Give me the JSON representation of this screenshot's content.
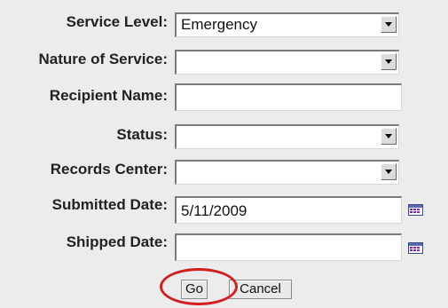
{
  "form": {
    "service_level": {
      "label": "Service Level:",
      "value": "Emergency"
    },
    "nature_of_service": {
      "label": "Nature of Service:",
      "value": ""
    },
    "recipient_name": {
      "label": "Recipient Name:",
      "value": ""
    },
    "status": {
      "label": "Status:",
      "value": ""
    },
    "records_center": {
      "label": "Records Center:",
      "value": ""
    },
    "submitted_date": {
      "label": "Submitted Date:",
      "value": "5/11/2009"
    },
    "shipped_date": {
      "label": "Shipped Date:",
      "value": ""
    }
  },
  "buttons": {
    "go": "Go",
    "cancel": "Cancel"
  },
  "icons": {
    "dropdown": "chevron-down-icon",
    "calendar": "calendar-icon"
  },
  "colors": {
    "highlight": "#d21f1f",
    "background": "#ececec"
  }
}
